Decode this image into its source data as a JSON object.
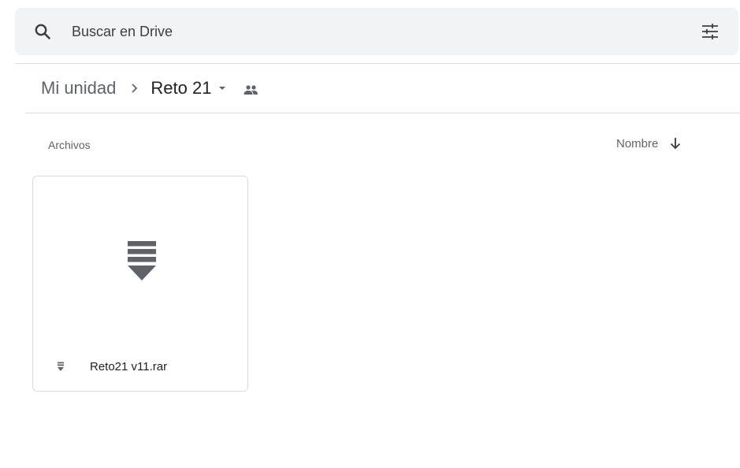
{
  "search": {
    "placeholder": "Buscar en Drive"
  },
  "breadcrumb": {
    "root": "Mi unidad",
    "current": "Reto 21"
  },
  "section": {
    "label": "Archivos",
    "sort_label": "Nombre"
  },
  "files": [
    {
      "name": "Reto21 v11.rar",
      "icon": "archive-icon"
    }
  ],
  "colors": {
    "search_bg": "#f1f3f4",
    "icon_gray": "#5f6368",
    "divider": "#dadce0",
    "text_primary": "#202124"
  }
}
